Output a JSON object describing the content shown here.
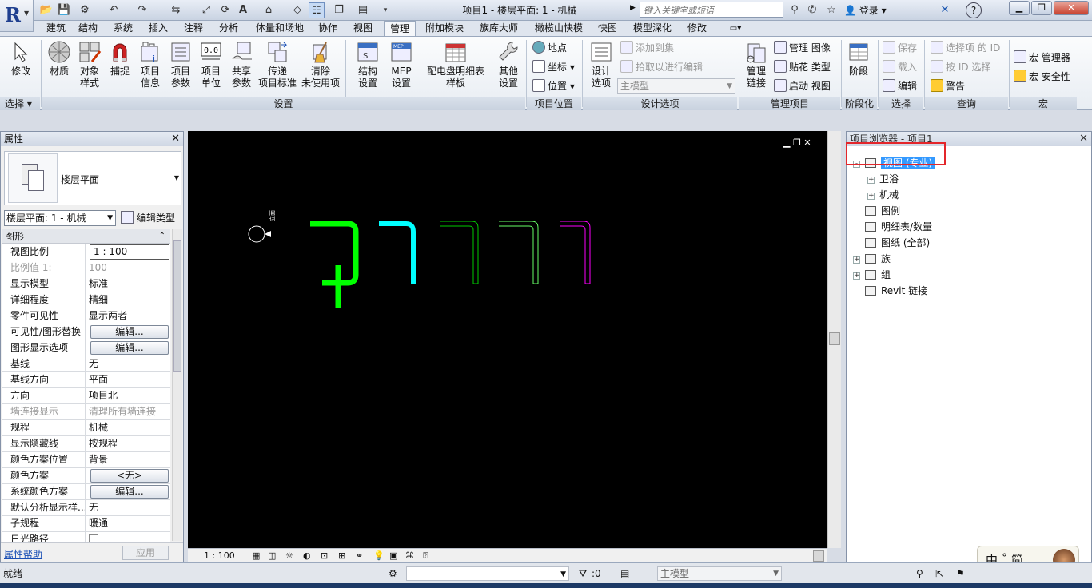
{
  "titlebar": {
    "doc_title": "项目1 - 楼层平面: 1 - 机械",
    "search_placeholder": "键入关键字或短语",
    "login": "登录",
    "help": "?",
    "app_logo": "R"
  },
  "tabs": [
    "建筑",
    "结构",
    "系统",
    "插入",
    "注释",
    "分析",
    "体量和场地",
    "协作",
    "视图",
    "管理",
    "附加模块",
    "族库大师",
    "橄榄山快模",
    "快图",
    "模型深化",
    "修改"
  ],
  "active_tab": "管理",
  "ribbon": {
    "select": {
      "button": "修改",
      "panel": "选择 ▾"
    },
    "settings": {
      "panel": "设置",
      "buttons": [
        "材质",
        "对象\n样式",
        "捕捉",
        "项目\n信息",
        "项目\n参数",
        "项目\n单位",
        "共享\n参数",
        "传递\n项目标准",
        "清除\n未使用项",
        "结构\n设置",
        "MEP\n设置",
        "配电盘明细表\n样板",
        "其他\n设置"
      ]
    },
    "location": {
      "panel": "项目位置",
      "items": [
        "地点",
        "坐标 ▾",
        "位置 ▾"
      ]
    },
    "design_options": {
      "panel": "设计选项",
      "button": "设计\n选项",
      "items": [
        "添加到集",
        "拾取以进行编辑"
      ],
      "combo": "主模型"
    },
    "manage_project": {
      "panel": "管理项目",
      "button": "管理\n链接",
      "items": [
        "管理 图像",
        "贴花 类型",
        "启动 视图"
      ]
    },
    "phasing": {
      "panel": "阶段化",
      "button": "阶段"
    },
    "selection": {
      "panel": "选择",
      "items": [
        "保存",
        "载入",
        "编辑"
      ]
    },
    "inquiry": {
      "panel": "查询",
      "items": [
        "选择项 的 ID",
        "按 ID 选择",
        "警告"
      ]
    },
    "macros": {
      "panel": "宏",
      "items": [
        "宏 管理器",
        "宏 安全性"
      ]
    }
  },
  "properties": {
    "title": "属性",
    "type_name": "楼层平面",
    "instance_selector": "楼层平面: 1 - 机械",
    "edit_type": "编辑类型",
    "group": "图形",
    "rows": [
      {
        "k": "视图比例",
        "v": "1 : 100",
        "kind": "input"
      },
      {
        "k": "比例值 1:",
        "v": "100",
        "kind": "disabled"
      },
      {
        "k": "显示模型",
        "v": "标准"
      },
      {
        "k": "详细程度",
        "v": "精细"
      },
      {
        "k": "零件可见性",
        "v": "显示两者"
      },
      {
        "k": "可见性/图形替换",
        "v": "编辑...",
        "kind": "button"
      },
      {
        "k": "图形显示选项",
        "v": "编辑...",
        "kind": "button"
      },
      {
        "k": "基线",
        "v": "无"
      },
      {
        "k": "基线方向",
        "v": "平面"
      },
      {
        "k": "方向",
        "v": "项目北"
      },
      {
        "k": "墙连接显示",
        "v": "清理所有墙连接",
        "kind": "disabled"
      },
      {
        "k": "规程",
        "v": "机械"
      },
      {
        "k": "显示隐藏线",
        "v": "按规程"
      },
      {
        "k": "颜色方案位置",
        "v": "背景"
      },
      {
        "k": "颜色方案",
        "v": "<无>",
        "kind": "button"
      },
      {
        "k": "系统颜色方案",
        "v": "编辑...",
        "kind": "button"
      },
      {
        "k": "默认分析显示样...",
        "v": "无"
      },
      {
        "k": "子规程",
        "v": "暖通"
      },
      {
        "k": "日光路径",
        "v": "",
        "kind": "checkbox"
      }
    ],
    "help": "属性帮助",
    "apply": "应用"
  },
  "canvas": {
    "background": "#000000",
    "elevation_marker": "立面"
  },
  "view_bar": {
    "scale": "1 : 100"
  },
  "browser": {
    "title": "项目浏览器 - 项目1",
    "nodes": [
      {
        "label": "视图 (专业)",
        "level": 0,
        "pm": "-",
        "selected": true
      },
      {
        "label": "卫浴",
        "level": 1,
        "pm": "+"
      },
      {
        "label": "机械",
        "level": 1,
        "pm": "+"
      },
      {
        "label": "图例",
        "level": 0,
        "pm": ""
      },
      {
        "label": "明细表/数量",
        "level": 0,
        "pm": ""
      },
      {
        "label": "图纸 (全部)",
        "level": 0,
        "pm": ""
      },
      {
        "label": "族",
        "level": 0,
        "pm": "+"
      },
      {
        "label": "组",
        "level": 0,
        "pm": "+"
      },
      {
        "label": "Revit 链接",
        "level": 0,
        "pm": ""
      }
    ]
  },
  "ime": {
    "text": "中 ˚ 简"
  },
  "statusbar": {
    "text": "就绪",
    "filter_count": ":0",
    "model": "主模型"
  }
}
